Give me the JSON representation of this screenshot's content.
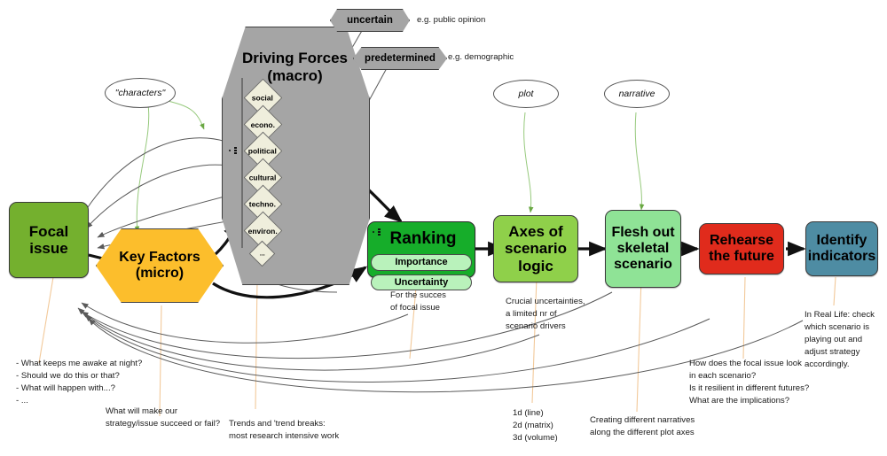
{
  "diagram": {
    "title": "Scenario planning process diagram",
    "colors": {
      "focal_green": "#74b02e",
      "key_factors_orange": "#fcbe2c",
      "driving_forces_grey": "#a5a5a5",
      "ranking_green": "#16ad2a",
      "axes_green": "#8fd04a",
      "flesh_green": "#8fe396",
      "rehearse_red": "#e02b1c",
      "identify_blue": "#4e8ca3",
      "diamond_cream": "#efeedc",
      "pill_green": "#b9f2bb"
    }
  },
  "nodes": {
    "focal_issue": "Focal issue",
    "key_factors": "Key Factors\n(micro)",
    "driving_forces": "Driving Forces\n(macro)",
    "ranking": "Ranking",
    "ranking_pills": [
      "Importance",
      "Uncertainty"
    ],
    "axes": "Axes of\nscenario\nlogic",
    "flesh_out": "Flesh out\nskeletal\nscenario",
    "rehearse": "Rehearse\nthe future",
    "identify": "Identify\nindicators"
  },
  "driving_force_categories": [
    "social",
    "econo.",
    "political",
    "cultural",
    "techno.",
    "environ.",
    "..."
  ],
  "tags": {
    "uncertain": "uncertain",
    "predetermined": "predetermined",
    "uncertain_example": "e.g. public opinion",
    "predetermined_example": "e.g. demographic"
  },
  "ellipses": {
    "characters": "\"characters\"",
    "plot": "plot",
    "narrative": "narrative"
  },
  "notes": {
    "focal_questions": "- What keeps me awake at night?\n- Should we do this or that?\n- What will happen with...?\n- ...",
    "key_factors": "What will make our\nstrategy/issue succeed or fail?",
    "driving_forces": "Trends and 'trend breaks:\nmost research intensive work",
    "ranking": "For the succes\nof focal issue",
    "axes": "Crucial uncertainties,\na limited nr of\nscenario drivers",
    "dimensions": "1d (line)\n2d (matrix)\n3d (volume)",
    "flesh_out": "Creating different narratives\nalong the different plot axes",
    "rehearse": "How does the focal issue look\nin each scenario?\nIs it resilient in different futures?\nWhat are the implications?",
    "identify": "In Real Life: check\nwhich scenario is\nplaying out and\nadjust strategy\naccordingly."
  }
}
